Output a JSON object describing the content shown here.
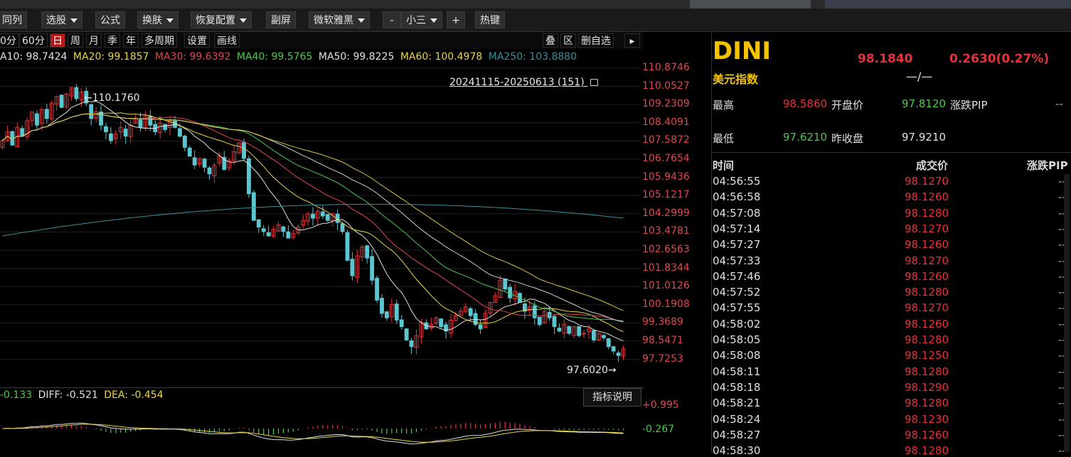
{
  "toolbar": {
    "items": [
      {
        "label": "同列",
        "dropdown": false
      },
      {
        "label": "选股",
        "dropdown": true
      },
      {
        "label": "公式",
        "dropdown": false
      },
      {
        "label": "换肤",
        "dropdown": true
      },
      {
        "label": "恢复配置",
        "dropdown": true
      },
      {
        "label": "副屏",
        "dropdown": false
      },
      {
        "label": "微软雅黑",
        "dropdown": true
      },
      {
        "label": "-",
        "dropdown": false
      },
      {
        "label": "小三",
        "dropdown": true
      },
      {
        "label": "+",
        "dropdown": false
      },
      {
        "label": "热键",
        "dropdown": false
      }
    ]
  },
  "periods": {
    "items": [
      "0分",
      "60分",
      "日",
      "周",
      "月",
      "季",
      "年",
      "多周期",
      "设置",
      "画线"
    ],
    "active": "日",
    "right_items": [
      "叠",
      "区",
      "删自选"
    ]
  },
  "ma_values": [
    {
      "label": "A10: 98.7424",
      "color": "#e0e0e0"
    },
    {
      "label": "MA20: 99.1857",
      "color": "#e8d44d"
    },
    {
      "label": "MA30: 99.6392",
      "color": "#e0474f"
    },
    {
      "label": "MA40: 99.5765",
      "color": "#4ec94e"
    },
    {
      "label": "MA50: 99.8225",
      "color": "#e0e0e0"
    },
    {
      "label": "MA60: 100.4978",
      "color": "#e8d44d"
    },
    {
      "label": "MA250: 103.8880",
      "color": "#3a8f9b"
    }
  ],
  "chart": {
    "range_label": "20241115-20250613 (151)",
    "high_marker": "110.1760",
    "low_marker": "97.6020",
    "axis_labels": [
      "110.8746",
      "110.0527",
      "109.2309",
      "108.4091",
      "107.5872",
      "106.7654",
      "105.9436",
      "105.1217",
      "104.2999",
      "103.4781",
      "102.6563",
      "101.8344",
      "101.0126",
      "100.1908",
      "99.3689",
      "98.5471",
      "97.7253"
    ],
    "indicator_button": "指标说明",
    "macd_line": {
      "macd": "-0.133",
      "diff_label": "DIFF: -0.521",
      "dea_label": "DEA: -0.454"
    },
    "macd_axis": [
      "+0.995",
      "-0.267"
    ]
  },
  "chart_data": {
    "type": "candlestick",
    "ylim": [
      97.2,
      111.0
    ],
    "y_ticks": [
      110.8746,
      110.0527,
      109.2309,
      108.4091,
      107.5872,
      106.7654,
      105.9436,
      105.1217,
      104.2999,
      103.4781,
      102.6563,
      101.8344,
      101.0126,
      100.1908,
      99.3689,
      98.5471,
      97.7253
    ],
    "close": [
      107.6,
      108.0,
      107.4,
      108.2,
      107.8,
      108.5,
      108.9,
      108.3,
      109.0,
      108.6,
      109.3,
      109.6,
      109.1,
      109.7,
      110.0,
      109.5,
      109.8,
      109.3,
      108.6,
      108.9,
      108.3,
      108.0,
      107.6,
      107.9,
      108.2,
      107.8,
      108.3,
      108.6,
      108.2,
      108.7,
      108.3,
      108.0,
      108.4,
      108.1,
      108.5,
      108.2,
      107.8,
      107.3,
      106.9,
      106.5,
      106.8,
      106.4,
      106.1,
      106.5,
      106.9,
      106.3,
      106.7,
      107.1,
      107.5,
      106.8,
      105.2,
      104.0,
      103.7,
      103.5,
      103.3,
      103.6,
      103.8,
      103.5,
      103.2,
      103.4,
      103.7,
      104.0,
      104.3,
      104.1,
      104.4,
      104.2,
      104.0,
      104.3,
      103.9,
      103.5,
      102.2,
      101.5,
      102.4,
      102.8,
      102.3,
      101.3,
      100.4,
      99.8,
      99.6,
      100.2,
      99.5,
      99.2,
      98.6,
      98.3,
      98.8,
      99.4,
      99.1,
      99.3,
      99.6,
      99.2,
      99.0,
      99.5,
      99.7,
      99.9,
      100.1,
      99.7,
      99.3,
      99.1,
      99.8,
      100.3,
      100.6,
      101.3,
      100.9,
      100.5,
      100.8,
      100.3,
      99.9,
      100.1,
      99.6,
      99.3,
      99.9,
      99.6,
      99.2,
      99.0,
      99.3,
      98.9,
      99.2,
      98.8,
      98.9,
      99.1,
      98.6,
      98.9,
      98.7,
      98.3,
      98.1,
      97.9,
      98.2
    ],
    "ma_series": [
      {
        "name": "MA250",
        "start": 103.3,
        "end": 104.1,
        "peak": 104.8
      }
    ],
    "macd": {
      "diff": -0.521,
      "dea": -0.454,
      "macd": -0.133
    }
  },
  "quote": {
    "symbol": "DINI",
    "name": "美元指数",
    "price": "98.1840",
    "change": "0.2630(0.27%)",
    "sub": "—/—",
    "rows": [
      {
        "l1": "最高",
        "v1": "98.5860",
        "c1": "#e6333a",
        "l2": "开盘价",
        "v2": "97.8120",
        "c2": "#4ec94e",
        "l3": "涨跌PIP",
        "v3": "--"
      },
      {
        "l1": "最低",
        "v1": "97.6210",
        "c1": "#4ec94e",
        "l2": "昨收盘",
        "v2": "97.9210",
        "c2": "#e0e0e0",
        "l3": "",
        "v3": ""
      }
    ]
  },
  "ticks": {
    "headers": [
      "时间",
      "成交价",
      "涨跌PIP"
    ],
    "rows": [
      [
        "04:56:55",
        "98.1270",
        "--"
      ],
      [
        "04:56:58",
        "98.1260",
        "--"
      ],
      [
        "04:57:08",
        "98.1280",
        "--"
      ],
      [
        "04:57:14",
        "98.1270",
        "--"
      ],
      [
        "04:57:27",
        "98.1260",
        "--"
      ],
      [
        "04:57:33",
        "98.1270",
        "--"
      ],
      [
        "04:57:46",
        "98.1260",
        "--"
      ],
      [
        "04:57:52",
        "98.1280",
        "--"
      ],
      [
        "04:57:55",
        "98.1270",
        "--"
      ],
      [
        "04:58:02",
        "98.1260",
        "--"
      ],
      [
        "04:58:05",
        "98.1280",
        "--"
      ],
      [
        "04:58:08",
        "98.1250",
        "--"
      ],
      [
        "04:58:11",
        "98.1280",
        "--"
      ],
      [
        "04:58:18",
        "98.1290",
        "--"
      ],
      [
        "04:58:21",
        "98.1280",
        "--"
      ],
      [
        "04:58:24",
        "98.1230",
        "--"
      ],
      [
        "04:58:27",
        "98.1260",
        "--"
      ],
      [
        "04:58:30",
        "98.1280",
        "--"
      ]
    ]
  }
}
